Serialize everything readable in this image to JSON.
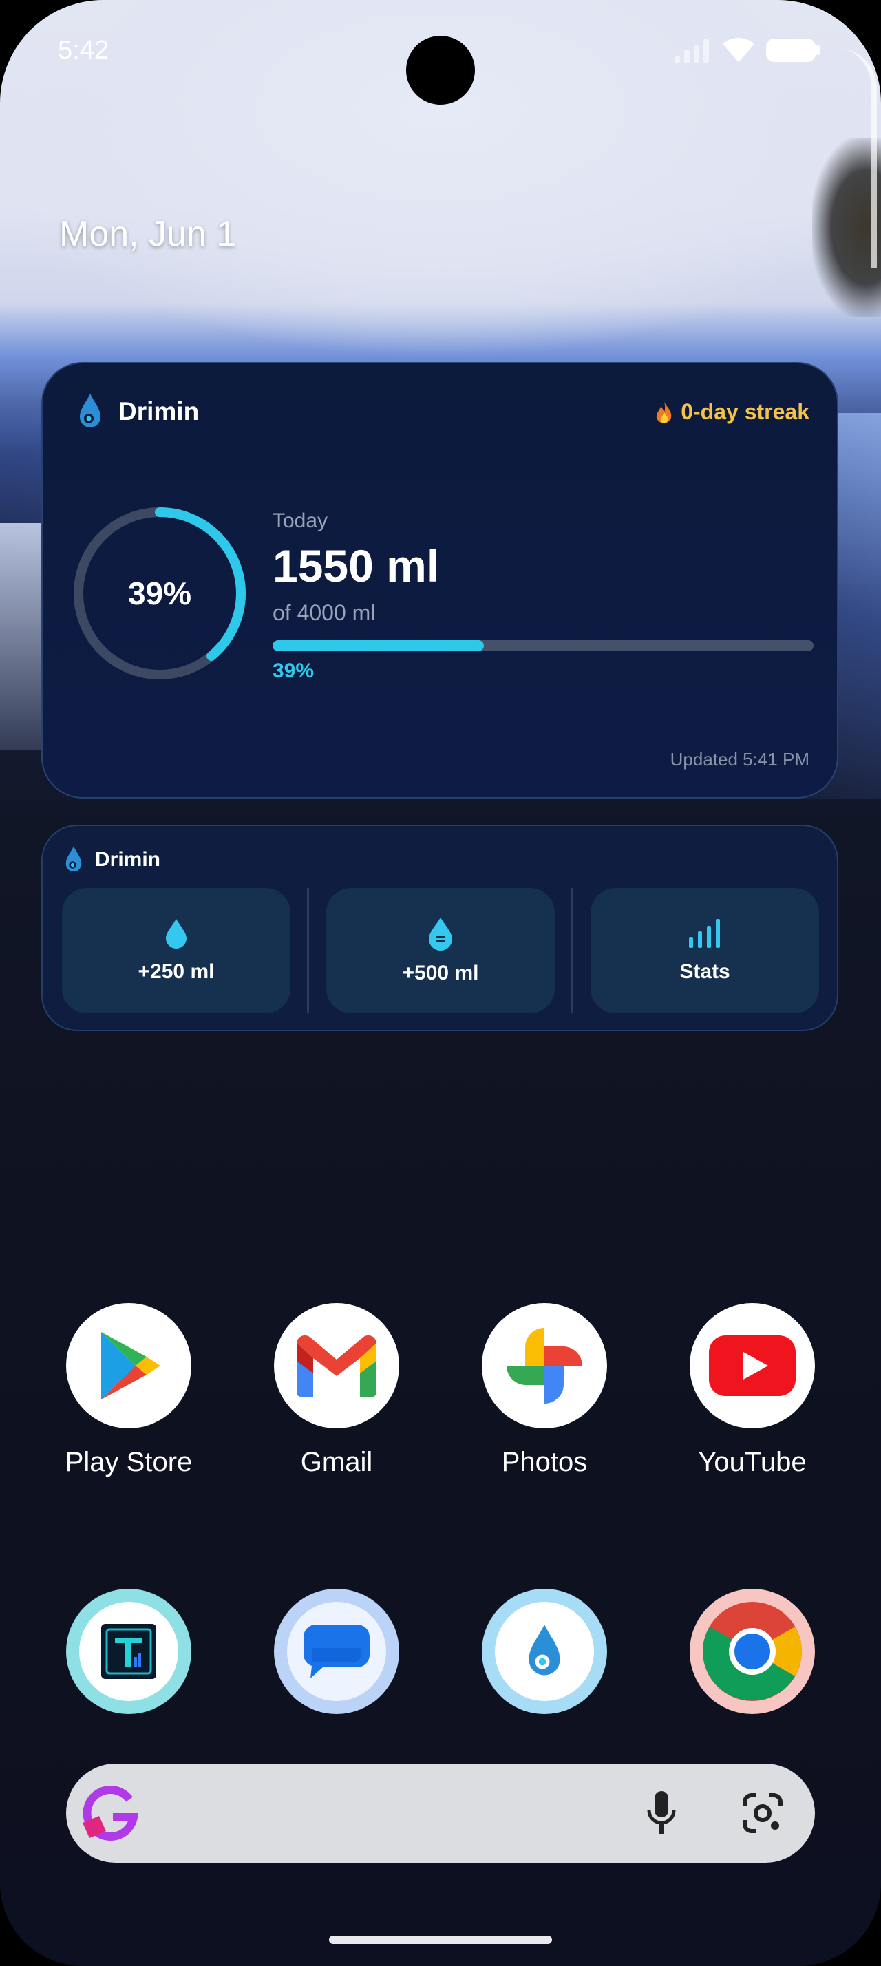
{
  "status_bar": {
    "time": "5:42"
  },
  "date": "Mon, Jun 1",
  "widget_main": {
    "app_name": "Drimin",
    "streak": "0-day streak",
    "ring_percent_label": "39%",
    "today_label": "Today",
    "amount": "1550 ml",
    "goal": "of 4000 ml",
    "progress_fraction": 0.39,
    "progress_label": "39%",
    "updated": "Updated 5:41 PM"
  },
  "widget_actions": {
    "app_name": "Drimin",
    "buttons": [
      {
        "label": "+250 ml",
        "icon": "water-drop-icon"
      },
      {
        "label": "+500 ml",
        "icon": "water-glass-icon"
      },
      {
        "label": "Stats",
        "icon": "bar-chart-icon"
      }
    ]
  },
  "apps_row1": [
    {
      "label": "Play Store",
      "icon": "play-store-icon"
    },
    {
      "label": "Gmail",
      "icon": "gmail-icon"
    },
    {
      "label": "Photos",
      "icon": "photos-icon"
    },
    {
      "label": "YouTube",
      "icon": "youtube-icon"
    }
  ],
  "apps_row2": [
    {
      "icon": "t-app-icon"
    },
    {
      "icon": "messages-icon"
    },
    {
      "icon": "drimin-icon"
    },
    {
      "icon": "chrome-icon"
    }
  ],
  "colors": {
    "accent": "#2ec8ea",
    "streak": "#f5c24a",
    "card_bg": "#0e1c45"
  }
}
